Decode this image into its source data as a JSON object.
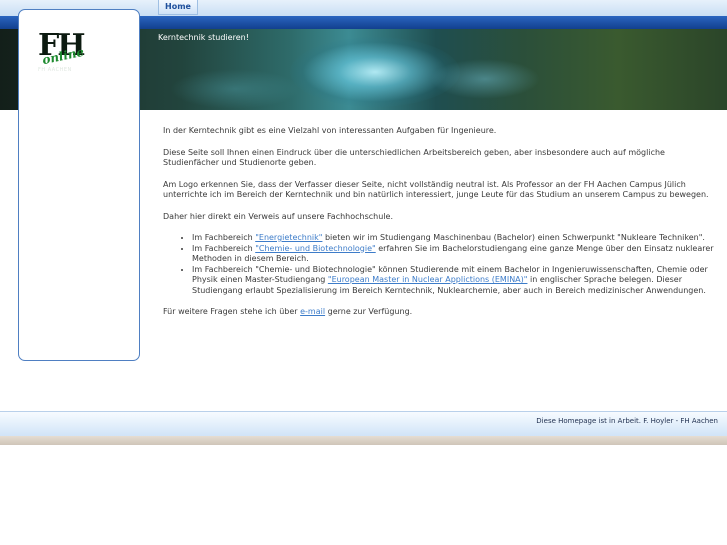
{
  "nav": {
    "home_label": "Home"
  },
  "banner": {
    "title": "Kerntechnik studieren!"
  },
  "logo": {
    "main": "FH",
    "script": "online",
    "sub": "FH AACHEN"
  },
  "content": {
    "intro": "In der Kerntechnik gibt es eine Vielzahl von interessanten Aufgaben für Ingenieure.",
    "p2": "Diese Seite soll Ihnen einen Eindruck über die unterschiedlichen Arbeitsbereich geben, aber insbesondere auch auf mögliche Studienfächer und Studienorte geben.",
    "p3": "Am Logo erkennen Sie, dass der Verfasser dieser Seite, nicht vollständig neutral ist. Als Professor an der FH Aachen Campus Jülich unterrichte ich im Bereich der Kerntechnik und bin natürlich interessiert, junge Leute für das Studium an unserem Campus zu bewegen.",
    "p4": "Daher hier direkt ein Verweis auf unsere Fachhochschule.",
    "list": [
      {
        "pre": "Im Fachbereich ",
        "link": "\"Energietechnik\"",
        "post": " bieten wir im Studiengang Maschinenbau (Bachelor) einen Schwerpunkt \"Nukleare Techniken\"."
      },
      {
        "pre": "Im Fachbereich ",
        "link": "\"Chemie- und Biotechnologie\"",
        "post": " erfahren Sie im Bachelorstudiengang eine ganze Menge über den Einsatz nuklearer Methoden in diesem Bereich."
      },
      {
        "pre": "Im Fachbereich \"Chemie- und Biotechnologie\" können Studierende mit einem Bachelor in Ingenieruwissenschaften, Chemie oder Physik einen Master-Studiengang ",
        "link": "\"European Master in Nuclear Applictions (EMINA)\"",
        "post": " in englischer Sprache belegen. Dieser Studiengang erlaubt Spezialisierung im Bereich Kerntechnik, Nuklearchemie, aber auch in Bereich medizinischer Anwendungen."
      }
    ],
    "closing_pre": "Für weitere Fragen stehe ich über ",
    "closing_link": "e-mail",
    "closing_post": " gerne zur Verfügung."
  },
  "footer": {
    "text": "Diese Homepage ist in Arbeit. F. Hoyler - FH Aachen"
  },
  "colors": {
    "accent": "#1f4f9c",
    "link": "#3d7cc9",
    "bluebar": "#12408e"
  }
}
